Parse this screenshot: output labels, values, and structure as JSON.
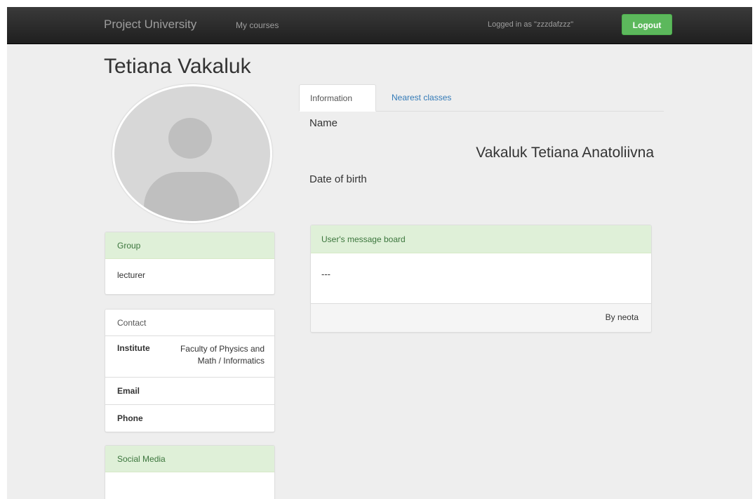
{
  "navbar": {
    "brand": "Project University",
    "my_courses": "My courses",
    "logged_in_text": "Logged in as \"zzzdafzzz\"",
    "logout_label": "Logout"
  },
  "profile": {
    "title": "Tetiana Vakaluk"
  },
  "group_panel": {
    "heading": "Group",
    "value": "lecturer"
  },
  "contact_panel": {
    "heading": "Contact",
    "institute_label": "Institute",
    "institute_value": "Faculty of Physics and Math / Informatics",
    "email_label": "Email",
    "phone_label": "Phone"
  },
  "social_panel": {
    "heading": "Social Media"
  },
  "tabs": {
    "information": "Information",
    "nearest_classes": "Nearest classes"
  },
  "info": {
    "name_label": "Name",
    "name_value": "Vakaluk Tetiana Anatoliivna",
    "dob_label": "Date of birth"
  },
  "message_board": {
    "heading": "User's message board",
    "body": "---",
    "footer": "By neota"
  },
  "colors": {
    "navbar_bg": "#222222",
    "logout_btn": "#5cb85c",
    "panel_heading_green": "#dff0d8",
    "link_blue": "#337ab7",
    "page_bg": "#eeeeee"
  },
  "icons": {
    "avatar": "user-silhouette-icon"
  }
}
